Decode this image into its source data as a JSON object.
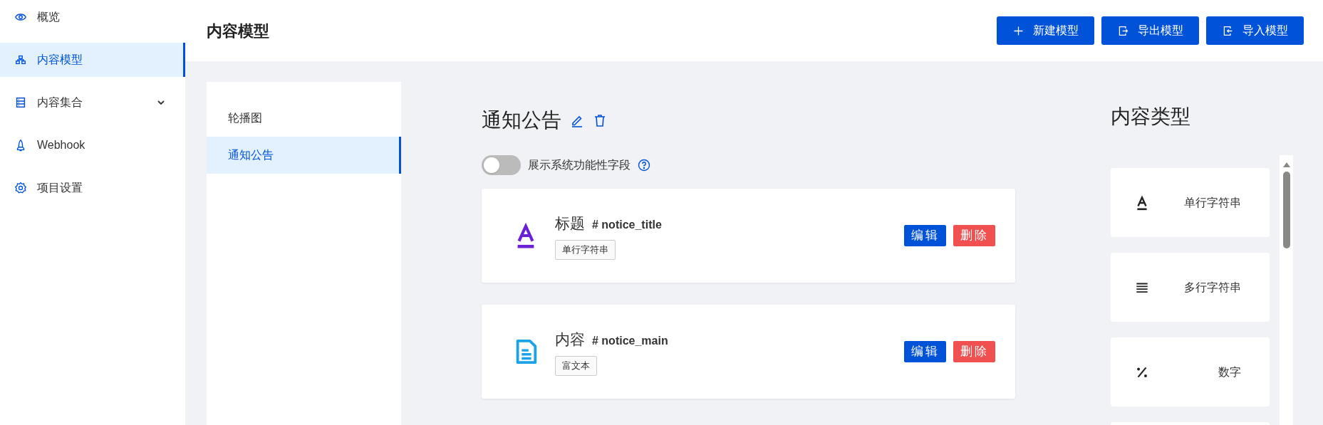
{
  "sidebar": {
    "items": [
      {
        "label": "概览",
        "kind": "eye",
        "selected": false
      },
      {
        "label": "内容模型",
        "kind": "model",
        "selected": true
      },
      {
        "label": "内容集合",
        "kind": "list",
        "selected": false,
        "expandable": true
      },
      {
        "label": "Webhook",
        "kind": "rocket",
        "selected": false
      },
      {
        "label": "项目设置",
        "kind": "gear",
        "selected": false
      }
    ]
  },
  "header": {
    "title": "内容模型",
    "buttons": [
      {
        "label": "新建模型",
        "kind": "plus"
      },
      {
        "label": "导出模型",
        "kind": "export"
      },
      {
        "label": "导入模型",
        "kind": "import"
      }
    ]
  },
  "models": {
    "items": [
      {
        "label": "轮播图",
        "selected": false
      },
      {
        "label": "通知公告",
        "selected": true
      }
    ]
  },
  "detail": {
    "title": "通知公告",
    "toggle": {
      "label": "展示系统功能性字段",
      "on": false
    },
    "fields": [
      {
        "name": "标题",
        "key": "# notice_title",
        "type": "单行字符串",
        "kind": "text",
        "actions": [
          "编辑",
          "删除"
        ]
      },
      {
        "name": "内容",
        "key": "# notice_main",
        "type": "富文本",
        "kind": "doc",
        "actions": [
          "编辑",
          "删除"
        ]
      }
    ]
  },
  "types": {
    "title": "内容类型",
    "items": [
      {
        "label": "单行字符串",
        "kind": "text"
      },
      {
        "label": "多行字符串",
        "kind": "lines"
      },
      {
        "label": "数字",
        "kind": "number"
      }
    ]
  }
}
